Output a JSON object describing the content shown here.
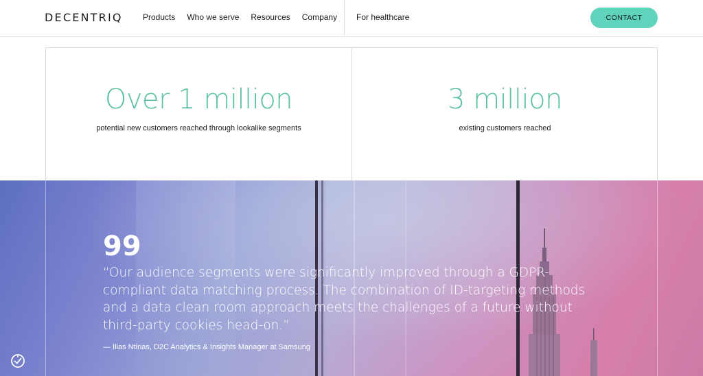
{
  "header": {
    "logo": "DECENTRIQ",
    "nav": [
      "Products",
      "Who we serve",
      "Resources",
      "Company"
    ],
    "healthcare": "For healthcare",
    "contact": "CONTACT"
  },
  "stats": [
    {
      "value": "Over 1 million",
      "caption": "potential new customers reached through lookalike segments"
    },
    {
      "value": "3 million",
      "caption": "existing customers reached"
    }
  ],
  "testimonial": {
    "quote_mark": "99",
    "quote": "“Our audience segments were significantly improved through a GDPR-compliant data matching process. The combination of ID-targeting methods and a data clean room approach meets the challenges of a future without third-party cookies head-on.”",
    "author": "— Ilias Ntinas, D2C Analytics & Insights Manager at Samsung"
  },
  "colors": {
    "accent": "#5fd3bc",
    "stat_text": "#5bbfa6"
  },
  "icons": {
    "consent": "cookie-consent-icon"
  }
}
